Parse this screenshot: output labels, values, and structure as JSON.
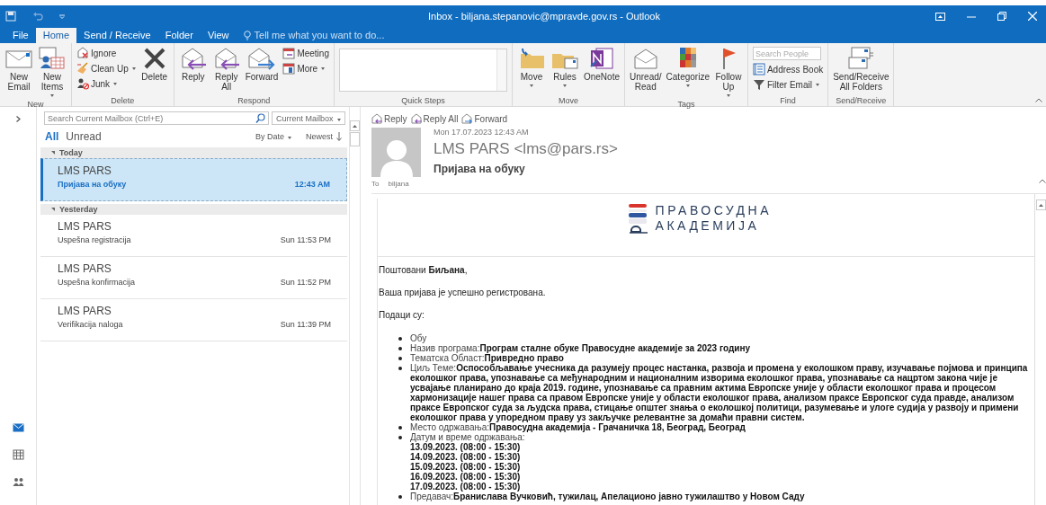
{
  "window": {
    "title": "Inbox - biljana.stepanovic@mpravde.gov.rs - Outlook"
  },
  "ribbon_tabs": [
    {
      "label": "File",
      "selected": false
    },
    {
      "label": "Home",
      "selected": true
    },
    {
      "label": "Send / Receive",
      "selected": false
    },
    {
      "label": "Folder",
      "selected": false
    },
    {
      "label": "View",
      "selected": false
    }
  ],
  "tell_me": {
    "placeholder": "Tell me what you want to do..."
  },
  "ribbon_groups": [
    {
      "label": "New",
      "items": [
        {
          "kind": "large",
          "label": "New\nEmail",
          "dropdown": false
        },
        {
          "kind": "large",
          "label": "New\nItems",
          "dropdown": true
        }
      ]
    },
    {
      "label": "Delete",
      "items": [
        {
          "kind": "stack",
          "items": [
            {
              "label": "Ignore",
              "dropdown": false
            },
            {
              "label": "Clean Up",
              "dropdown": true
            },
            {
              "label": "Junk",
              "dropdown": true
            }
          ]
        },
        {
          "kind": "large",
          "label": "Delete",
          "dropdown": false
        }
      ]
    },
    {
      "label": "Respond",
      "items": [
        {
          "kind": "large",
          "label": "Reply",
          "dropdown": false
        },
        {
          "kind": "large",
          "label": "Reply\nAll",
          "dropdown": false
        },
        {
          "kind": "large",
          "label": "Forward",
          "dropdown": false
        },
        {
          "kind": "stack",
          "items": [
            {
              "label": "Meeting",
              "dropdown": false
            },
            {
              "label": "More",
              "dropdown": true
            }
          ]
        }
      ]
    },
    {
      "label": "Quick Steps",
      "items": [
        {
          "kind": "gallery"
        }
      ]
    },
    {
      "label": "Move",
      "items": [
        {
          "kind": "large",
          "label": "Move",
          "dropdown": true
        },
        {
          "kind": "large",
          "label": "Rules",
          "dropdown": true
        },
        {
          "kind": "large",
          "label": "OneNote",
          "dropdown": false
        }
      ]
    },
    {
      "label": "Tags",
      "items": [
        {
          "kind": "large",
          "label": "Unread/\nRead",
          "dropdown": false
        },
        {
          "kind": "large",
          "label": "Categorize",
          "dropdown": true
        },
        {
          "kind": "large",
          "label": "Follow\nUp",
          "dropdown": true
        }
      ]
    },
    {
      "label": "Find",
      "items": [
        {
          "kind": "stack",
          "items": [
            {
              "kind": "search",
              "placeholder": "Search People"
            },
            {
              "label": "Address Book",
              "dropdown": false
            },
            {
              "label": "Filter Email",
              "dropdown": true
            }
          ]
        }
      ]
    },
    {
      "label": "Send/Receive",
      "items": [
        {
          "kind": "large",
          "label": "Send/Receive\nAll Folders",
          "dropdown": false
        }
      ]
    }
  ],
  "nav": [
    {
      "selected": true
    },
    {
      "selected": false
    },
    {
      "selected": false
    }
  ],
  "mail_list": {
    "search": {
      "placeholder": "Search Current Mailbox (Ctrl+E)"
    },
    "scope": "Current Mailbox",
    "filters": [
      {
        "label": "All",
        "selected": true
      },
      {
        "label": "Unread",
        "selected": false
      }
    ],
    "sort": "By Date",
    "order": "Newest",
    "groups": [
      {
        "label": "Today",
        "expanded": true,
        "messages": [
          {
            "sender": "LMS PARS",
            "subject": "Пријава на обуку",
            "time": "12:43 AM",
            "selected": true
          }
        ]
      },
      {
        "label": "Yesterday",
        "expanded": true,
        "messages": [
          {
            "sender": "LMS PARS",
            "subject": "Uspešna registracija",
            "time": "Sun 11:53 PM",
            "selected": false
          },
          {
            "sender": "LMS PARS",
            "subject": "Uspešna konfirmacija",
            "time": "Sun 11:52 PM",
            "selected": false
          },
          {
            "sender": "LMS PARS",
            "subject": "Verifikacija naloga",
            "time": "Sun 11:39 PM",
            "selected": false
          }
        ]
      }
    ]
  },
  "reading_pane": {
    "actions": [
      "Reply",
      "Reply All",
      "Forward"
    ],
    "date": "Mon 17.07.2023 12:43 AM",
    "from": "LMS PARS <lms@pars.rs>",
    "subject": "Пријава на обуку",
    "to_label": "To",
    "to": "biljana",
    "logo": [
      "ПРАВОСУДНА",
      "АКАДЕМИЈА"
    ],
    "paragraphs": [
      "Поштовани **Биљана**,",
      "Ваша пријава је успешно регистрована.",
      "Подаци су:"
    ],
    "list": [
      {
        "text": "Обу"
      },
      {
        "text": "Назив програма:**Програм сталне обуке Правосудне академије за 2023 годину**"
      },
      {
        "text": "Тематска Област:**Привредно право**"
      },
      {
        "text": "Циљ Теме:**Оспособљавање учесника да разумеју процес настанка, развоја и промена у еколошком праву, изучавање појмова и принципа еколошког права, упознавање са међународним и националним изворима еколошког права, упознавање са нацртом закона чије је усвајање планирано до краја 2019. године, упознавање са правним актима Европске уније у области еколошког права и процесом хармонизације нашег права са правом Европске уније у области еколошког права, анализом праксе Европског суда правде, анализом праксе Европског суда за људска права, стицање општег знања о еколошкој политици, разумевање и улоге судија у развоју и примени еколошког права у упоредном праву уз закључке релевантне за домаћи правни систем.**"
      },
      {
        "text": "Место одржавања:**Правосудна академија - Грачаничка 18, Београд, Београд**"
      },
      {
        "text": "Датум и време одржавања:",
        "lines": [
          "13.09.2023. (08:00 - 15:30)",
          "14.09.2023. (08:00 - 15:30)",
          "15.09.2023. (08:00 - 15:30)",
          "16.09.2023. (08:00 - 15:30)",
          "17.09.2023. (08:00 - 15:30)"
        ]
      },
      {
        "text": "Предавач:**Бранислава Вучковић, тужилац, Апелационо јавно тужилаштво у Новом Саду**"
      }
    ]
  }
}
